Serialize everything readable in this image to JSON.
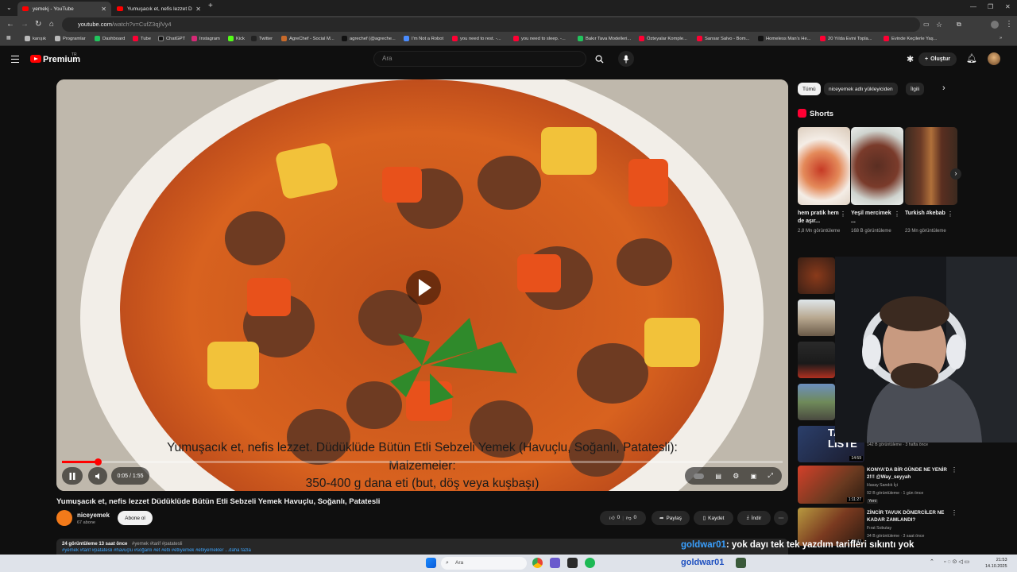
{
  "browser": {
    "tabs": [
      {
        "title": "yemekj - YouTube"
      },
      {
        "title": "Yumuşacık et, nefis lezzet Düdüklü"
      }
    ],
    "url_host": "youtube.com",
    "url_path": "/watch?v=CufZ3qjlVy4",
    "bookmarks": [
      "karışık",
      "Programlar",
      "Dashboard",
      "Tube",
      "ChatGPT",
      "Instagram",
      "Kick",
      "Twitter",
      "AgreChef - Social M...",
      "agrechef (@agreche...",
      "I'm Not a Robot",
      "you need to rest. -...",
      "you need to sleep. -...",
      "Bakır Tava Modelleri...",
      "Özteyalar Komple...",
      "Sansar Salvo - Bom...",
      "Homeless Man's He...",
      "20 Yılda Evini Topla...",
      "Evinde Keçilerle Yaş..."
    ]
  },
  "youtube": {
    "brand": "Premium",
    "brand_sup": "TR",
    "search_placeholder": "Ara",
    "create_label": "Oluştur"
  },
  "player": {
    "caption_line1": "Yumuşacık et, nefis lezzet. Düdüklüde Bütün Etli Sebzeli Yemek (Havuçlu, Soğanlı, Patatesli):",
    "caption_line2": "Malzemeler:",
    "caption_line3": "350-400 g dana eti (but, döş veya kuşbaşı)",
    "time": "0:05 / 1:55",
    "progress": 0.05
  },
  "video": {
    "title": "Yumuşacık et, nefis lezzet Düdüklüde Bütün Etli Sebzeli Yemek Havuçlu, Soğanlı, Patatesli",
    "channel": "niceyemek",
    "subscribers": "67 abone",
    "subscribe_label": "Abone ol",
    "likes": "0",
    "dislikes": "0",
    "share_label": "Paylaş",
    "save_label": "Kaydet",
    "download_label": "İndir",
    "views_line": "24 görüntüleme  13 saat önce",
    "hashtags_line": "#yemek #tarif #patatesli",
    "more_line": "#yemek #tarif #patatesli #havuçlu #soğanlı #et #etli #etliyemek #etliyemekler  ...daha fazla"
  },
  "sidebar": {
    "chips": [
      "Tümü",
      "niceyemek adlı yükleyiciden",
      "İlgili"
    ],
    "shorts_heading": "Shorts",
    "shorts": [
      {
        "title": "hem pratik hem de aşır...",
        "views": "2,8 Mn görüntüleme"
      },
      {
        "title": "Yeşil mercimek ...",
        "views": "168 B görüntüleme"
      },
      {
        "title": "Turkish #kebab",
        "views": "23 Mn görüntüleme"
      }
    ],
    "partial_meta": "142 B görüntüleme · 3 hafta önce",
    "thumb_overlay": "TA LISTE",
    "thumb_duration": "14:59",
    "videos": [
      {
        "title": "KONYA'DA BİR GÜNDE NE YENİR 2!!! @Way_seyyah",
        "channel": "Hasay Sandık İçi",
        "meta": "92 B görüntüleme · 1 gün önce",
        "badge": "Yeni",
        "duration": "1:11:27"
      },
      {
        "title": "ZİNCİR TAVUK DÖNERCİLER NE KADAR ZAMLANDI?",
        "channel": "Fırat Sobutay",
        "meta": "34 B görüntüleme · 3 saat önce",
        "duration": "28:42"
      }
    ]
  },
  "chat": {
    "user": "goldwar01",
    "message": ": yok dayı tek tek yazdım tarifleri sıkıntı yok"
  },
  "taskbar": {
    "search": "Ara",
    "overlay_name": "goldwar01",
    "time": "21:53",
    "date": "14.10.2025"
  },
  "colors": {
    "accent": "#ff0000",
    "background": "#0f0f0f",
    "chip": "#272727",
    "chat_user": "#3aa0ff"
  }
}
